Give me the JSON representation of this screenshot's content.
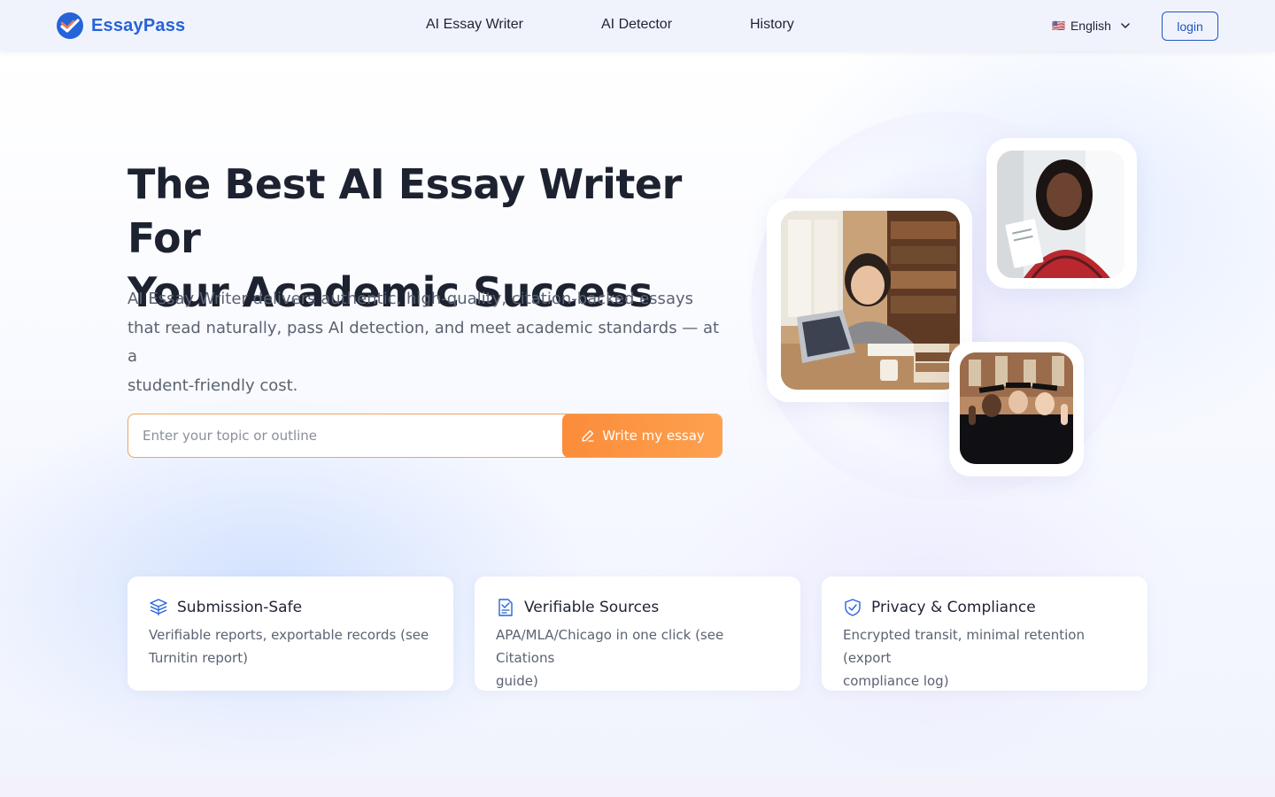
{
  "brand": {
    "name": "EssayPass",
    "accent": "#2563d9"
  },
  "nav": {
    "links": [
      {
        "label": "AI Essay Writer"
      },
      {
        "label": "AI Detector"
      },
      {
        "label": "History"
      }
    ],
    "language": {
      "flag": "🇺🇸",
      "label": "English"
    },
    "login_label": "login"
  },
  "hero": {
    "title_line1": "The Best AI Essay Writer For",
    "title_line2": "Your Academic Success",
    "subtitle_line1": "AI Essay Writer delivers authentic, high-quality, citation-backed essays",
    "subtitle_line2": "that read naturally, pass AI detection, and meet academic standards — at a",
    "subtitle_line3": "student-friendly cost.",
    "input_placeholder": "Enter your topic or outline",
    "button_label": "Write my essay",
    "button_color": "#fb8c3a"
  },
  "features": [
    {
      "icon": "box-stack-icon",
      "title": "Submission-Safe",
      "desc_line1": "Verifiable reports, exportable records (see",
      "desc_line2": "Turnitin report)"
    },
    {
      "icon": "document-check-icon",
      "title": "Verifiable Sources",
      "desc_line1": "APA/MLA/Chicago in one click (see Citations",
      "desc_line2": "guide)"
    },
    {
      "icon": "shield-icon",
      "title": "Privacy & Compliance",
      "desc_line1": "Encrypted transit, minimal retention (export",
      "desc_line2": "compliance log)"
    }
  ]
}
